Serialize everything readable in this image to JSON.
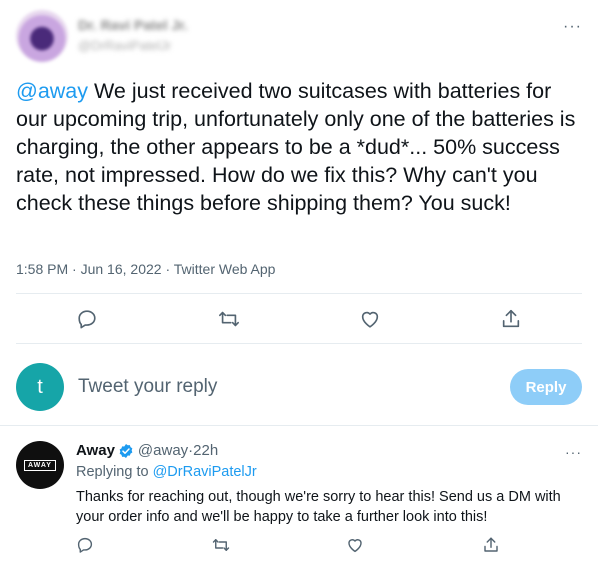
{
  "tweet": {
    "author_name": "Dr. Ravi Patel Jr.",
    "author_handle": "@DrRaviPatelJr",
    "more_label": "···",
    "mention": "@away",
    "text_body": " We just received two suitcases with batteries for our upcoming trip, unfortunately only one of the batteries is charging, the other appears to be a *dud*... 50% success rate, not impressed. How do we fix this? Why can't you check these things before shipping them? You suck!",
    "time": "1:58 PM",
    "date": "Jun 16, 2022",
    "source": "Twitter Web App",
    "separator": " · "
  },
  "icons": {
    "reply": "comment-icon",
    "retweet": "retweet-icon",
    "like": "heart-icon",
    "share": "share-icon"
  },
  "composer": {
    "avatar_letter": "t",
    "placeholder": "Tweet your reply",
    "button_label": "Reply",
    "avatar_color": "#16a5a8",
    "button_color": "#8ecdf8"
  },
  "reply": {
    "name": "Away",
    "handle": "@away",
    "age": "22h",
    "separator": " · ",
    "replying_prefix": "Replying to ",
    "replying_to": "@DrRaviPatelJr",
    "logo_text": "AWAY",
    "text": "Thanks for reaching out, though we're sorry to hear this! Send us a DM with your order info and we'll be happy to take a further look into this!",
    "more_label": "···"
  },
  "colors": {
    "accent": "#1d9bf0",
    "secondary_text": "#536471",
    "divider": "#e6ecf0"
  }
}
